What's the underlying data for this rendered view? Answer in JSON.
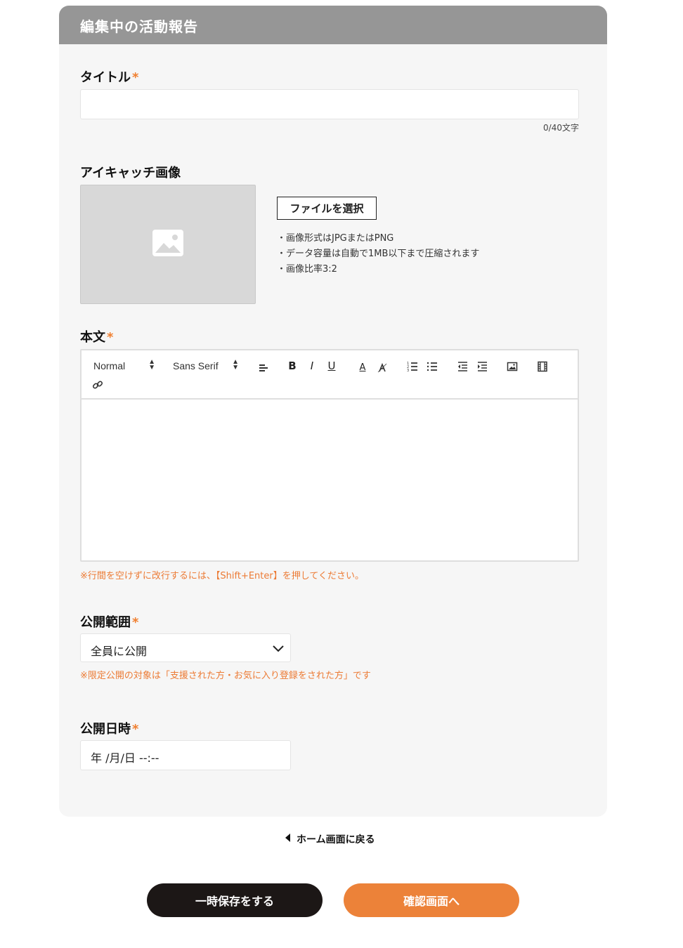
{
  "header": {
    "title": "編集中の活動報告"
  },
  "form": {
    "title_field": {
      "label": "タイトル",
      "required_mark": "*",
      "value": "",
      "counter": "0/40文字"
    },
    "eyecatch": {
      "label": "アイキャッチ画像",
      "file_button": "ファイルを選択",
      "notes": [
        "・画像形式はJPGまたはPNG",
        "・データ容量は自動で1MB以下まで圧縮されます",
        "・画像比率3:2"
      ]
    },
    "body": {
      "label": "本文",
      "required_mark": "*",
      "toolbar": {
        "size": "Normal",
        "font": "Sans Serif"
      },
      "hint": "※行間を空けずに改行するには、【Shift+Enter】を押してください。"
    },
    "visibility": {
      "label": "公開範囲",
      "required_mark": "*",
      "selected": "全員に公開",
      "note": "※限定公開の対象は「支援された方・お気に入り登録をされた方」です"
    },
    "publish_date": {
      "label": "公開日時",
      "required_mark": "*",
      "value": "年 /月/日 --:--"
    }
  },
  "footer": {
    "back_link": "ホーム画面に戻る",
    "save_button": "一時保存をする",
    "confirm_button": "確認画面へ"
  },
  "colors": {
    "accent": "#ec8239",
    "dark": "#1c1716",
    "header_bg": "#969696",
    "card_bg": "#f6f6f6"
  }
}
